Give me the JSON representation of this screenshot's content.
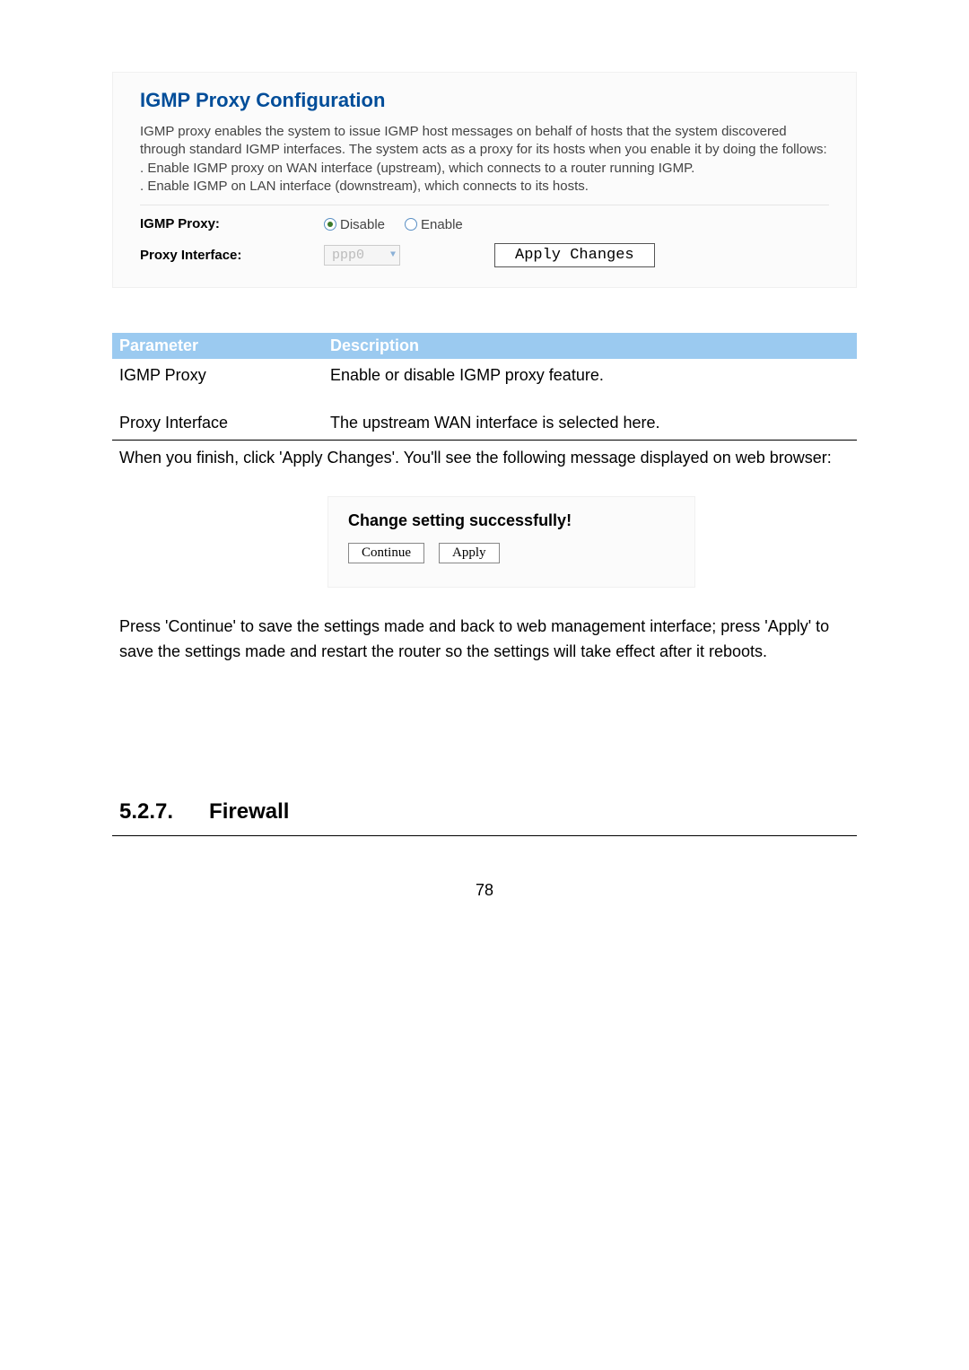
{
  "configPanel": {
    "title": "IGMP Proxy Configuration",
    "description": "IGMP proxy enables the system to issue IGMP host messages on behalf of hosts that the system discovered through standard IGMP interfaces. The system acts as a proxy for its hosts when you enable it by doing the follows:\n. Enable IGMP proxy on WAN interface (upstream), which connects to a router running IGMP.\n. Enable IGMP on LAN interface (downstream), which connects to its hosts.",
    "rows": {
      "igmpProxy": {
        "label": "IGMP Proxy:",
        "disableLabel": "Disable",
        "enableLabel": "Enable"
      },
      "proxyInterface": {
        "label": "Proxy Interface:",
        "value": "ppp0"
      }
    },
    "applyButton": "Apply Changes"
  },
  "paramTable": {
    "header": {
      "col1": "Parameter",
      "col2": "Description"
    },
    "row1": {
      "col1": "IGMP Proxy",
      "col2": "Enable or disable IGMP proxy feature."
    },
    "row2": {
      "col1": "Proxy Interface",
      "col2": "The upstream WAN interface is selected here."
    }
  },
  "bodyText1": "When you finish, click 'Apply Changes'. You'll see the following message displayed on web browser:",
  "successPanel": {
    "title": "Change setting successfully!",
    "continueBtn": "Continue",
    "applyBtn": "Apply"
  },
  "bodyText2": "Press 'Continue' to save the settings made and back to web management interface; press 'Apply' to save the settings made and restart the router so the settings will take effect after it reboots.",
  "section": {
    "number": "5.2.7.",
    "title": "Firewall"
  },
  "pageNumber": "78"
}
